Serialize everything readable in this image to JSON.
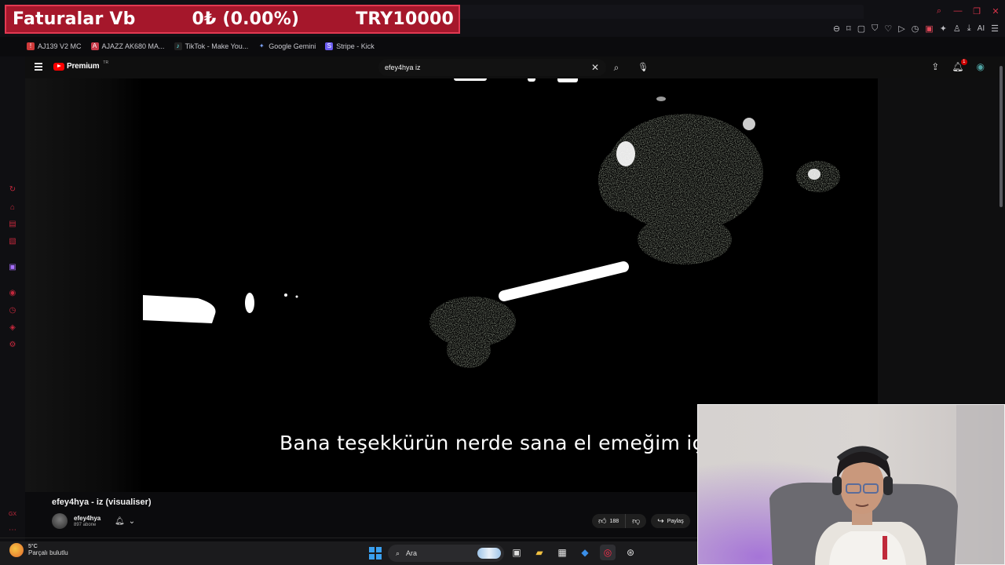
{
  "banner": {
    "title": "Faturalar Vb",
    "progress": "0₺ (0.00%)",
    "goal": "TRY10000"
  },
  "bookmarks": [
    {
      "label": "AJ139 V2 MC",
      "icon": "warning-icon",
      "color": "#d03a3a"
    },
    {
      "label": "AJAZZ AK680 MA...",
      "icon": "ajazz-icon",
      "color": "#c83a4a"
    },
    {
      "label": "TikTok - Make You...",
      "icon": "tiktok-icon",
      "color": "#222222"
    },
    {
      "label": "Google Gemini",
      "icon": "gemini-icon",
      "color": "#4a7be0"
    },
    {
      "label": "Stripe - Kick",
      "icon": "stripe-icon",
      "color": "#6b5cf0"
    }
  ],
  "toolbar": {
    "ai_label": "AI"
  },
  "youtube": {
    "logo_text": "Premium",
    "logo_region": "TR",
    "search_value": "efey4hya iz",
    "notification_count": "1"
  },
  "video": {
    "subtitle": "Bana teşekkürün nerde sana el emeğim iç",
    "title": "efey4hya - iz (visualiser)",
    "channel": "efey4hya",
    "subscribers": "897 abone",
    "likes": "188",
    "share_label": "Paylaş"
  },
  "taskbar": {
    "temperature": "5°C",
    "weather": "Parçalı bulutlu",
    "search_placeholder": "Ara"
  },
  "colors": {
    "banner_bg": "#a5172b",
    "accent_red": "#ff0000",
    "sidebar_icon": "#c2283c"
  }
}
